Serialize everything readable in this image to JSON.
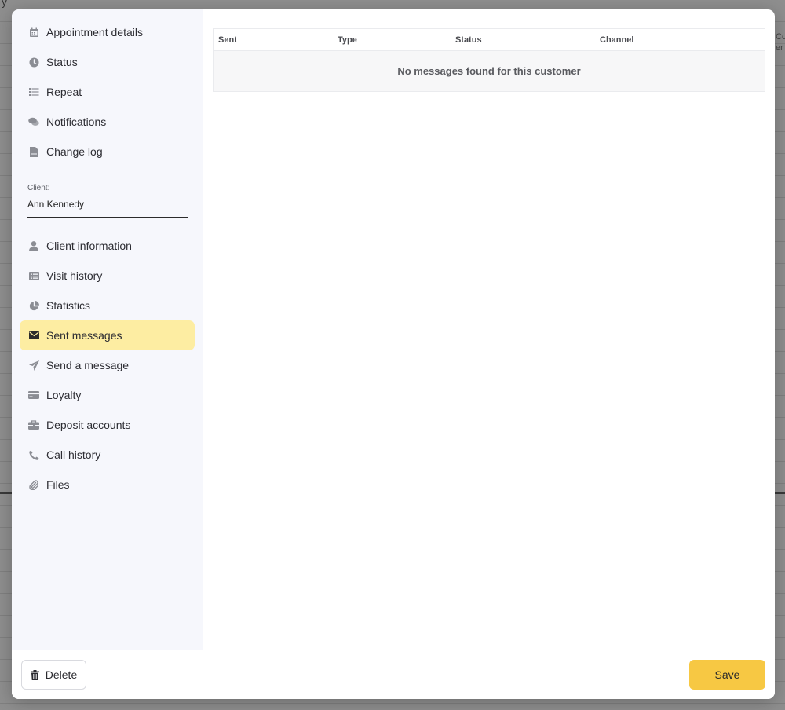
{
  "background": {
    "top_text": "y",
    "right_text_1": "Co",
    "right_text_2": "er"
  },
  "sidebar": {
    "items": [
      {
        "label": "Appointment details",
        "icon": "calendar-icon"
      },
      {
        "label": "Status",
        "icon": "clock-icon"
      },
      {
        "label": "Repeat",
        "icon": "list-icon"
      },
      {
        "label": "Notifications",
        "icon": "chat-icon"
      },
      {
        "label": "Change log",
        "icon": "document-icon"
      }
    ],
    "client": {
      "label": "Client:",
      "name": "Ann Kennedy"
    },
    "client_items": [
      {
        "label": "Client information",
        "icon": "user-icon"
      },
      {
        "label": "Visit history",
        "icon": "table-list-icon"
      },
      {
        "label": "Statistics",
        "icon": "pie-chart-icon"
      },
      {
        "label": "Sent messages",
        "icon": "envelope-icon",
        "active": true
      },
      {
        "label": "Send a message",
        "icon": "paper-plane-icon"
      },
      {
        "label": "Loyalty",
        "icon": "credit-card-icon"
      },
      {
        "label": "Deposit accounts",
        "icon": "briefcase-icon"
      },
      {
        "label": "Call history",
        "icon": "phone-icon"
      },
      {
        "label": "Files",
        "icon": "paperclip-icon"
      }
    ]
  },
  "table": {
    "columns": [
      "Sent",
      "Type",
      "Status",
      "Channel"
    ],
    "empty_message": "No messages found for this customer"
  },
  "footer": {
    "delete_label": "Delete",
    "save_label": "Save"
  },
  "colors": {
    "active_bg": "#fdeda2",
    "save_bg": "#f7c843",
    "sidebar_bg": "#f6f7fc"
  }
}
